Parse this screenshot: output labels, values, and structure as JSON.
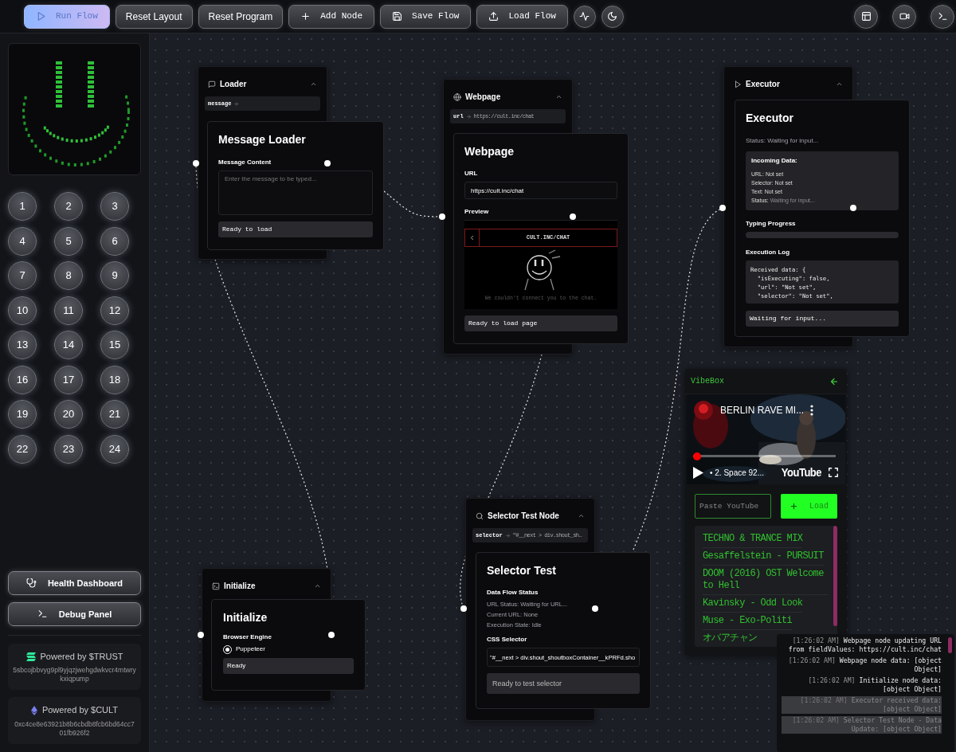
{
  "toolbar": {
    "buttons": [
      {
        "label": "Run Flow",
        "kind": "primary"
      },
      {
        "label": "Reset Layout",
        "kind": "plain"
      },
      {
        "label": "Reset Program",
        "kind": "plain"
      },
      {
        "label": "Add Node",
        "kind": "mono"
      },
      {
        "label": "Save Flow",
        "kind": "mono"
      },
      {
        "label": "Load Flow",
        "kind": "mono"
      }
    ]
  },
  "sidebar": {
    "number_buttons": [
      "1",
      "2",
      "3",
      "4",
      "5",
      "6",
      "7",
      "8",
      "9",
      "10",
      "11",
      "12",
      "13",
      "14",
      "15",
      "16",
      "17",
      "18",
      "19",
      "20",
      "21",
      "22",
      "23",
      "24"
    ],
    "actions": [
      "Health Dashboard",
      "Debug Panel"
    ],
    "credits": [
      {
        "title": "Powered by $TRUST",
        "address": "5sbcojbbvyg9pl9yjqzjwehgdwkvcr4mtwrykxiqpump"
      },
      {
        "title": "Powered by $CULT",
        "address": "0xc4ce8e63921b8b6cbdb8fcb6bd64cc701fb926f2"
      }
    ]
  },
  "loader": {
    "header": "Loader",
    "port_label": "message",
    "title": "Message Loader",
    "field_label": "Message Content",
    "placeholder": "Enter the message to be typed...",
    "status": "Ready to load"
  },
  "webpage": {
    "header": "Webpage",
    "port_label": "url",
    "port_value": "https://cult.inc/chat",
    "title": "Webpage",
    "url_label": "URL",
    "url_value": "https://cult.inc/chat",
    "preview_label": "Preview",
    "preview": {
      "title": "CULT.INC/CHAT",
      "message": "We couldn't connect you to the chat."
    },
    "status": "Ready to load page"
  },
  "executor": {
    "header": "Executor",
    "title": "Executor",
    "status": "Status: Waiting for input...",
    "incoming": {
      "title": "Incoming Data:",
      "lines": [
        {
          "label": "URL:",
          "value": "Not set",
          "muted": false
        },
        {
          "label": "Selector:",
          "value": "Not set",
          "muted": false
        },
        {
          "label": "Text:",
          "value": "Not set",
          "muted": false
        },
        {
          "label": "Status:",
          "value": "Waiting for input...",
          "muted": true
        }
      ]
    },
    "progress_label": "Typing Progress",
    "progress": {
      "level": 0
    },
    "log_label": "Execution Log",
    "log_lines": [
      "Received data: {",
      "  \"isExecuting\": false,",
      "  \"url\": \"Not set\",",
      "  \"selector\": \"Not set\","
    ],
    "log_status": "Waiting for input..."
  },
  "selector": {
    "header": "Selector Test Node",
    "port_label": "selector",
    "port_value": "\"#__next > div.shout_sh…",
    "title": "Selector Test",
    "status_title": "Data Flow Status",
    "status_lines": [
      "URL Status: Waiting for URL...",
      "Current URL: None",
      "Execution State: Idle"
    ],
    "css_label": "CSS Selector",
    "css_value": "\"#__next > div.shout_shoutboxContainer__kPRFd.sho",
    "status": "Ready to test selector"
  },
  "initialize": {
    "header": "Initialize",
    "title": "Initialize",
    "engine_label": "Browser Engine",
    "options": [
      {
        "label": "Puppeteer",
        "selected": true
      }
    ],
    "status": "Ready"
  },
  "vibebox": {
    "title": "VibeBox",
    "video": {
      "title": "BERLIN RAVE MI...",
      "chapter": "• 2. Space 92...",
      "logo": "YouTube",
      "progress": {
        "level": 0
      }
    },
    "placeholder": "Paste YouTube",
    "load_label": "Load",
    "playlist": [
      "TECHNO & TRANCE MIX",
      "Gesaffelstein - PURSUIT",
      "DOOM (2016) OST Welcome to Hell",
      "Kavinsky - Odd Look",
      "Muse - Exo-Politi",
      "オバアチャン"
    ]
  },
  "log_panel": {
    "entries": [
      {
        "time": "[1:26:02 AM]",
        "text": "Webpage node updating URL from fieldValues: https://cult.inc/chat",
        "highlighted": false
      },
      {
        "time": "[1:26:02 AM]",
        "text": "Webpage node data: [object Object]",
        "highlighted": false
      },
      {
        "time": "[1:26:02 AM]",
        "text": "Initialize node data: [object Object]",
        "highlighted": false
      },
      {
        "time": "[1:26:02 AM]",
        "text": "Executor received data: [object Object]",
        "highlighted": true
      },
      {
        "time": "[1:26:02 AM]",
        "text": "Selector Test Node - Data Update: [object Object]",
        "highlighted": true
      }
    ]
  }
}
